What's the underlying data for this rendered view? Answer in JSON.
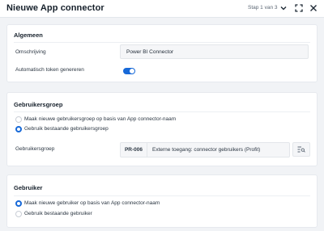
{
  "header": {
    "title": "Nieuwe App connector",
    "step": "Stap 1 van 3",
    "icons": [
      "chevron-down-icon",
      "fullscreen-icon",
      "close-icon"
    ]
  },
  "algemeen": {
    "title": "Algemeen",
    "omschrijving_label": "Omschrijving",
    "omschrijving_value": "Power BI Connector",
    "token_label": "Automatisch token genereren",
    "token_enabled": true
  },
  "gebruikersgroep": {
    "title": "Gebruikersgroep",
    "options": [
      {
        "label": "Maak nieuwe gebruikersgroep op basis van App connector-naam",
        "checked": false
      },
      {
        "label": "Gebruik bestaande gebruikersgroep",
        "checked": true
      }
    ],
    "field_label": "Gebruikersgroep",
    "code": "PR-006",
    "value": "Externe toegang: connector gebruikers (Profit)"
  },
  "gebruiker": {
    "title": "Gebruiker",
    "options": [
      {
        "label": "Maak nieuwe gebruiker op basis van App connector-naam",
        "checked": true
      },
      {
        "label": "Gebruik bestaande gebruiker",
        "checked": false
      }
    ]
  },
  "colors": {
    "accent": "#1769d8",
    "background": "#f1f3f6",
    "card": "#ffffff"
  }
}
